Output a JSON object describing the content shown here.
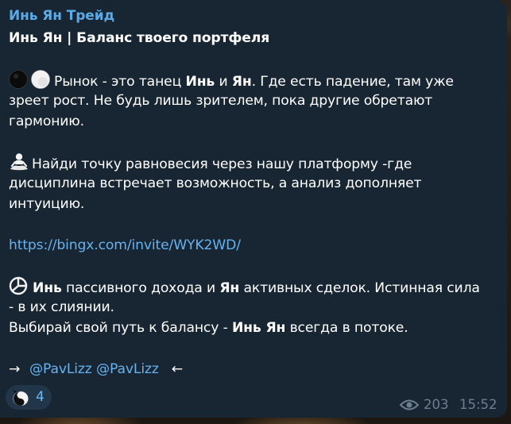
{
  "message": {
    "sender": "Инь Ян Трейд",
    "title": "Инь Ян | Баланс твоего портфеля",
    "p1": {
      "a": "Рынок - это танец ",
      "b": "Инь",
      "c": " и ",
      "d": "Ян",
      "e": ". Где есть падение, там уже",
      "line2": "зреет рост. Не будь лишь зрителем, пока другие обретают",
      "line3": "гармонию."
    },
    "p2": {
      "line1": "Найди точку равновесия через нашу платформу -где",
      "line2": "дисциплина встречает возможность, а анализ дополняет",
      "line3": "интуицию."
    },
    "link": "https://bingx.com/invite/WYK2WD/",
    "p3": {
      "a": "Инь",
      "b": " пассивного дохода и ",
      "c": "Ян",
      "d": " активных сделок. Истинная сила",
      "line2": "- в их слиянии.",
      "line3a": "Выбирай свой путь к балансу - ",
      "line3b": "Инь Ян",
      "line3c": " всегда в потоке."
    },
    "footer": {
      "arrow_right": "→",
      "mention1": "@PavLizz",
      "mention2": "@PavLizz",
      "arrow_left": "←"
    }
  },
  "reaction": {
    "icon": "yin-yang-emoji-icon",
    "count": "4"
  },
  "meta": {
    "views_icon": "eye-icon",
    "views": "203",
    "time": "15:52"
  },
  "colors": {
    "bubble": "#182533",
    "sender": "#5aabe8",
    "link": "#66b3f0",
    "text": "#ffffff",
    "meta": "#6d7f8f"
  }
}
